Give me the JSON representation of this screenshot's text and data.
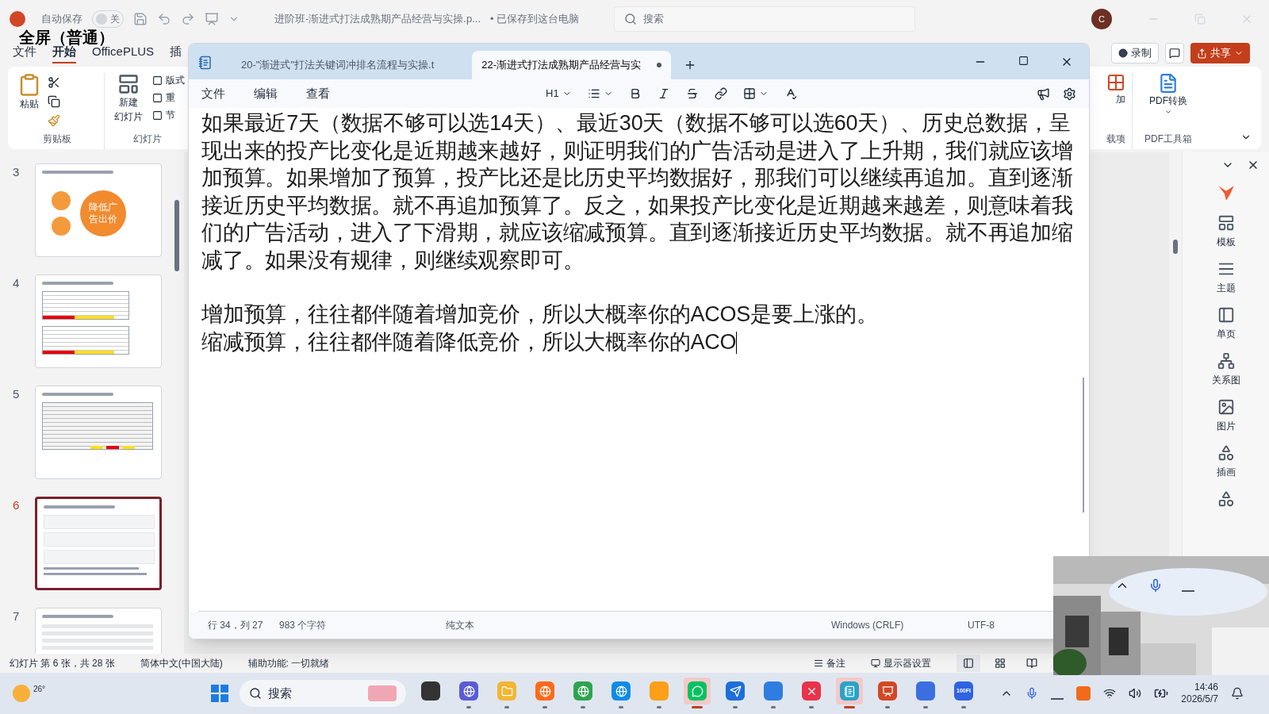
{
  "overlay_label": "全屏（普通）",
  "titlebar": {
    "autosave_label": "自动保存",
    "autosave": {
      "label": "关",
      "on": false
    },
    "doc_title": "进阶班-渐进式打法成熟期产品经营与实操.p...",
    "save_status": "• 已保存到这台电脑",
    "search_placeholder": "搜索",
    "avatar": "C"
  },
  "menu_tabs": [
    {
      "label": "文件",
      "selected": false
    },
    {
      "label": "开始",
      "selected": true
    },
    {
      "label": "OfficePLUS",
      "selected": false
    },
    {
      "label": "插",
      "selected": false
    }
  ],
  "ribbon": {
    "paste": "粘贴",
    "new_slide": [
      "新建",
      "幻灯片"
    ],
    "layout_items": [
      "版式",
      "重",
      "节"
    ],
    "groups": [
      "剪贴板",
      "幻灯片"
    ],
    "record": "录制",
    "share": "共享",
    "addin_partial": "加",
    "addin_group": "载项",
    "pdf": "PDF转换",
    "pdf_group": "PDF工具箱"
  },
  "slides": [
    {
      "number": "3",
      "selected": false,
      "kind": "circles",
      "text": "降低广告出价"
    },
    {
      "number": "4",
      "selected": false,
      "kind": "tables"
    },
    {
      "number": "5",
      "selected": false,
      "kind": "grid"
    },
    {
      "number": "6",
      "selected": true,
      "kind": "screens"
    },
    {
      "number": "7",
      "selected": false,
      "kind": "list"
    }
  ],
  "design_panel": [
    "模板",
    "主题",
    "单页",
    "关系图",
    "图片",
    "插画"
  ],
  "status": {
    "slide_info": "幻灯片 第 6 张，共 28 张",
    "language": "简体中文(中国大陆)",
    "accessibility": "辅助功能: 一切就绪",
    "notes": "备注",
    "display": "显示器设置",
    "views": [
      {
        "kind": "normal",
        "selected": true
      },
      {
        "kind": "sorter",
        "selected": false
      },
      {
        "kind": "reading",
        "selected": false
      }
    ]
  },
  "notepad": {
    "tabs": [
      {
        "label": "20-\"渐进式\"打法关键词冲排名流程与实操.t",
        "selected": false,
        "unsaved": false
      },
      {
        "label": "22-渐进式打法成熟期产品经营与实",
        "selected": true,
        "unsaved": true
      }
    ],
    "menu": [
      "文件",
      "编辑",
      "查看"
    ],
    "heading": "H1",
    "paragraphs": [
      "如果最近7天（数据不够可以选14天）、最近30天（数据不够可以选60天）、历史总数据，呈现出来的投产比变化是近期越来越好，则证明我们的广告活动是进入了上升期，我们就应该增加预算。如果增加了预算，投产比还是比历史平均数据好，那我们可以继续再追加。直到逐渐接近历史平均数据。就不再追加预算了。反之，如果投产比变化是近期越来越差，则意味着我们的广告活动，进入了下滑期，就应该缩减预算。直到逐渐接近历史平均数据。就不再追加缩减了。如果没有规律，则继续观察即可。",
      "增加预算，往往都伴随着增加竞价，所以大概率你的ACOS是要上涨的。",
      "缩减预算，往往都伴随着降低竞价，所以大概率你的ACO"
    ],
    "status": {
      "position": "行 34，列 27",
      "chars": "983 个字符",
      "format": "纯文本",
      "line_ending": "Windows (CRLF)",
      "encoding": "UTF-8"
    }
  },
  "taskbar": {
    "weather": "26°",
    "search": "搜索",
    "time": "14:46",
    "date": "2026/5/7",
    "apps": [
      {
        "color": "#333333",
        "selected": false,
        "running": false
      },
      {
        "color": "#5b5bd6",
        "selected": false,
        "running": true
      },
      {
        "color": "#f2b632",
        "selected": false,
        "running": true
      },
      {
        "color": "#ff6a1a",
        "selected": false,
        "running": true
      },
      {
        "color": "#2ea44f",
        "selected": false,
        "running": true
      },
      {
        "color": "#0c8ce9",
        "selected": false,
        "running": true
      },
      {
        "color": "#ff9f1a",
        "selected": false,
        "running": true
      },
      {
        "color": "#07c160",
        "selected": true,
        "running": true
      },
      {
        "color": "#1e6fd9",
        "selected": false,
        "running": true
      },
      {
        "color": "#2f7de1",
        "selected": false,
        "running": true
      },
      {
        "color": "#e8334a",
        "selected": false,
        "running": true
      },
      {
        "color": "#2aa3c9",
        "selected": true,
        "running": true
      },
      {
        "color": "#d24726",
        "selected": false,
        "running": true
      },
      {
        "color": "#3b6fe0",
        "selected": false,
        "running": true
      },
      {
        "color": "#2f63e0",
        "selected": false,
        "running": true,
        "label": "100FI"
      }
    ]
  }
}
